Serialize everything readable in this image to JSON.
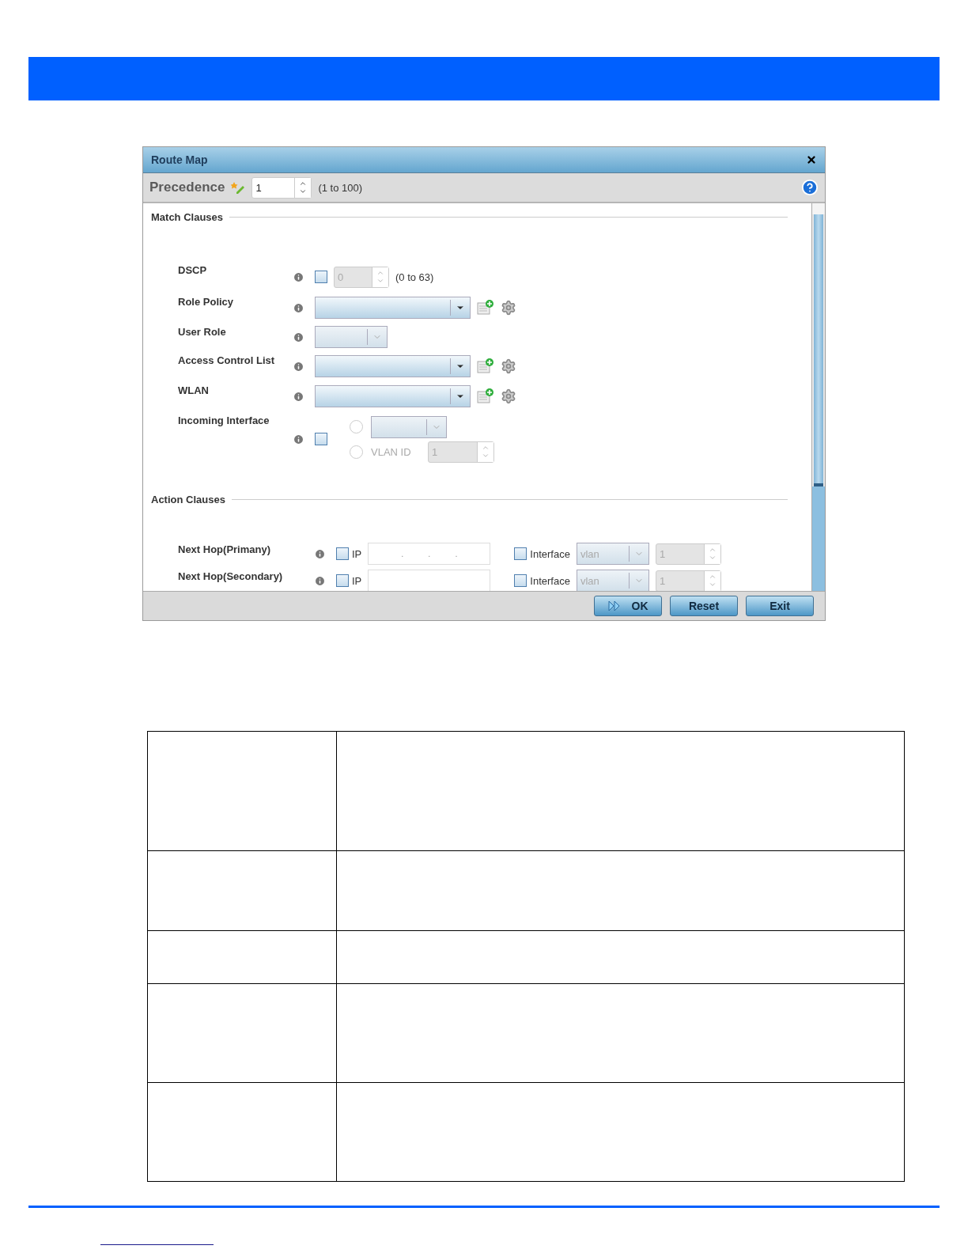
{
  "dialog": {
    "title": "Route Map",
    "precedence": {
      "label": "Precedence",
      "value": "1",
      "range": "(1 to 100)"
    },
    "sections": [
      {
        "title": "Match Clauses",
        "rows": [
          {
            "kind": "spinner",
            "label": "DSCP",
            "checked": false,
            "value": "0",
            "range": "(0 to 63)"
          },
          {
            "kind": "select_actions",
            "label": "Role Policy"
          },
          {
            "kind": "select_small",
            "label": "User Role"
          },
          {
            "kind": "select_actions",
            "label": "Access Control List"
          },
          {
            "kind": "select_actions",
            "label": "WLAN"
          },
          {
            "kind": "interface",
            "label": "Incoming Interface",
            "checked": false,
            "options": [
              {
                "kind": "select",
                "selected": false
              },
              {
                "kind": "vlan",
                "label": "VLAN ID",
                "value": "1",
                "selected": false
              }
            ]
          }
        ]
      },
      {
        "title": "Action Clauses",
        "rows": [
          {
            "kind": "next_hop",
            "label": "Next Hop(Primany)",
            "ip_label": "IP",
            "ip_checked": false,
            "ip_value": ". . .",
            "interface_label": "Interface",
            "interface_checked": false,
            "interface_value": "vlan",
            "number": "1"
          },
          {
            "kind": "next_hop",
            "label": "Next Hop(Secondary)",
            "ip_label": "IP",
            "ip_checked": false,
            "ip_value": "",
            "interface_label": "Interface",
            "interface_checked": false,
            "interface_value": "vlan",
            "number": "1"
          }
        ]
      }
    ],
    "buttons": [
      {
        "kind": "ok",
        "label": "OK"
      },
      {
        "kind": "plain",
        "label": "Reset"
      },
      {
        "kind": "plain",
        "label": "Exit"
      }
    ]
  }
}
